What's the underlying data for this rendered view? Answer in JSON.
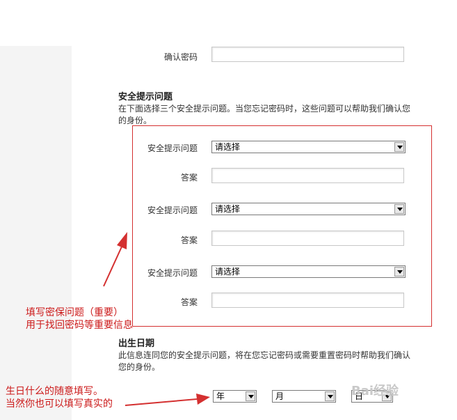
{
  "form": {
    "confirm_password_label": "确认密码",
    "security": {
      "title": "安全提示问题",
      "description": "在下面选择三个安全提示问题。当您忘记密码时，这些问题可以帮助我们确认您的身份。",
      "questions": [
        {
          "label": "安全提示问题",
          "selected": "请选择",
          "answer_label": "答案"
        },
        {
          "label": "安全提示问题",
          "selected": "请选择",
          "answer_label": "答案"
        },
        {
          "label": "安全提示问题",
          "selected": "请选择",
          "answer_label": "答案"
        }
      ]
    },
    "birthday": {
      "title": "出生日期",
      "description": "此信息连同您的安全提示问题，将在您忘记密码或需要重置密码时帮助我们确认您的身份。",
      "year": "年",
      "month": "月",
      "day": "日"
    }
  },
  "annotations": {
    "security_note_line1": "填写密保问题（重要）",
    "security_note_line2": "用于找回密码等重要信息",
    "birthday_note_line1": "生日什么的随意填写。",
    "birthday_note_line2": "当然你也可以填写真实的"
  },
  "watermark": {
    "text": "Bai经验"
  },
  "colors": {
    "annotation": "#cc1a1a",
    "highlight_border": "#d43030"
  }
}
